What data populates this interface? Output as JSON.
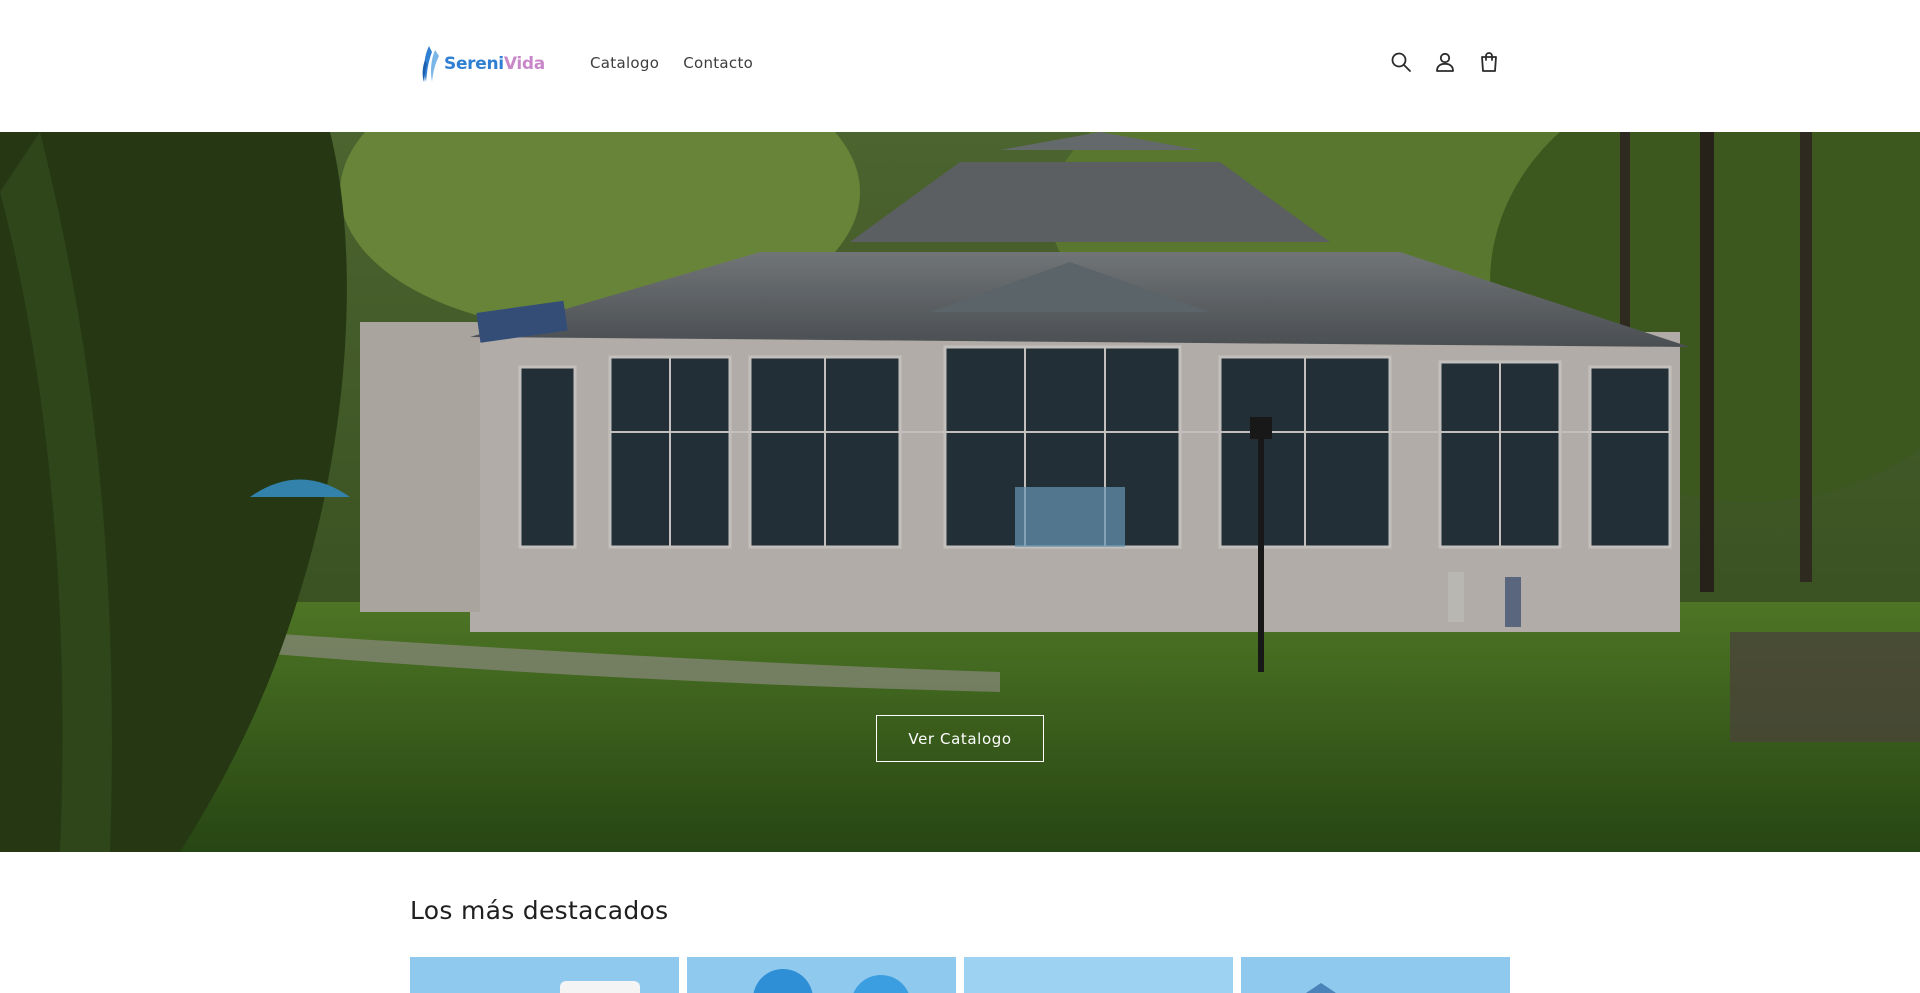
{
  "header": {
    "logo": {
      "part1": "Sereni",
      "part2": "Vida",
      "color1": "#2f7fd3",
      "color2": "#c887c9"
    },
    "nav": [
      {
        "label": "Catalogo"
      },
      {
        "label": "Contacto"
      }
    ],
    "icons": [
      "search-icon",
      "account-icon",
      "cart-icon"
    ]
  },
  "hero": {
    "image": "spa pavilion building with glass windows surrounded by trees and lawn",
    "button_label": "Ver Catalogo"
  },
  "featured": {
    "title": "Los más destacados",
    "cards": [
      {
        "name": "product-card-1"
      },
      {
        "name": "product-card-2"
      },
      {
        "name": "product-card-3"
      },
      {
        "name": "product-card-4"
      }
    ]
  }
}
